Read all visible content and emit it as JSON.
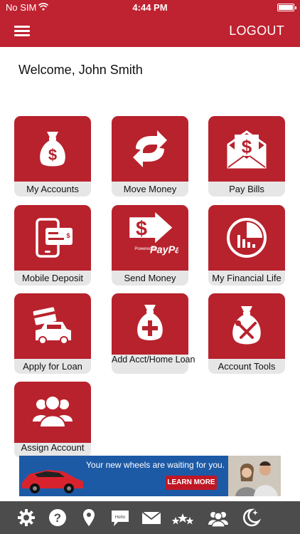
{
  "status_bar": {
    "carrier": "No SIM",
    "time": "4:44 PM"
  },
  "header": {
    "logout_label": "LOGOUT"
  },
  "welcome_text": "Welcome, John Smith",
  "tiles": [
    {
      "label": "My Accounts",
      "icon": "money-bag-icon"
    },
    {
      "label": "Move Money",
      "icon": "transfer-arrows-icon"
    },
    {
      "label": "Pay Bills",
      "icon": "bill-envelope-icon"
    },
    {
      "label": "Mobile Deposit",
      "icon": "mobile-check-icon"
    },
    {
      "label": "Send Money",
      "icon": "paypal-send-icon",
      "icon_text": "Powered by",
      "brand_text": "PayPal"
    },
    {
      "label": "My Financial Life",
      "icon": "pie-chart-icon"
    },
    {
      "label": "Apply for Loan",
      "icon": "car-loan-icon"
    },
    {
      "label": "Add Acct/Home Loan",
      "icon": "money-bag-plus-icon"
    },
    {
      "label": "Account Tools",
      "icon": "money-bag-tools-icon"
    },
    {
      "label": "Assign Account",
      "icon": "users-group-icon"
    }
  ],
  "banner": {
    "headline": "Your new wheels are waiting for you.",
    "button": "LEARN MORE"
  },
  "tab_bar": {
    "items": [
      {
        "icon": "gear-icon"
      },
      {
        "icon": "help-icon"
      },
      {
        "icon": "location-pin-icon"
      },
      {
        "icon": "chat-bubble-icon",
        "text": "Hello"
      },
      {
        "icon": "mail-icon"
      },
      {
        "icon": "stars-icon"
      },
      {
        "icon": "people-icon"
      },
      {
        "icon": "moon-icon"
      }
    ]
  },
  "colors": {
    "brand_red": "#bf2230",
    "tile_red": "#b8222d",
    "tile_label_bg": "#e6e6e6",
    "tab_bar_bg": "#4c4c4c",
    "banner_blue": "#1d5aa6"
  }
}
